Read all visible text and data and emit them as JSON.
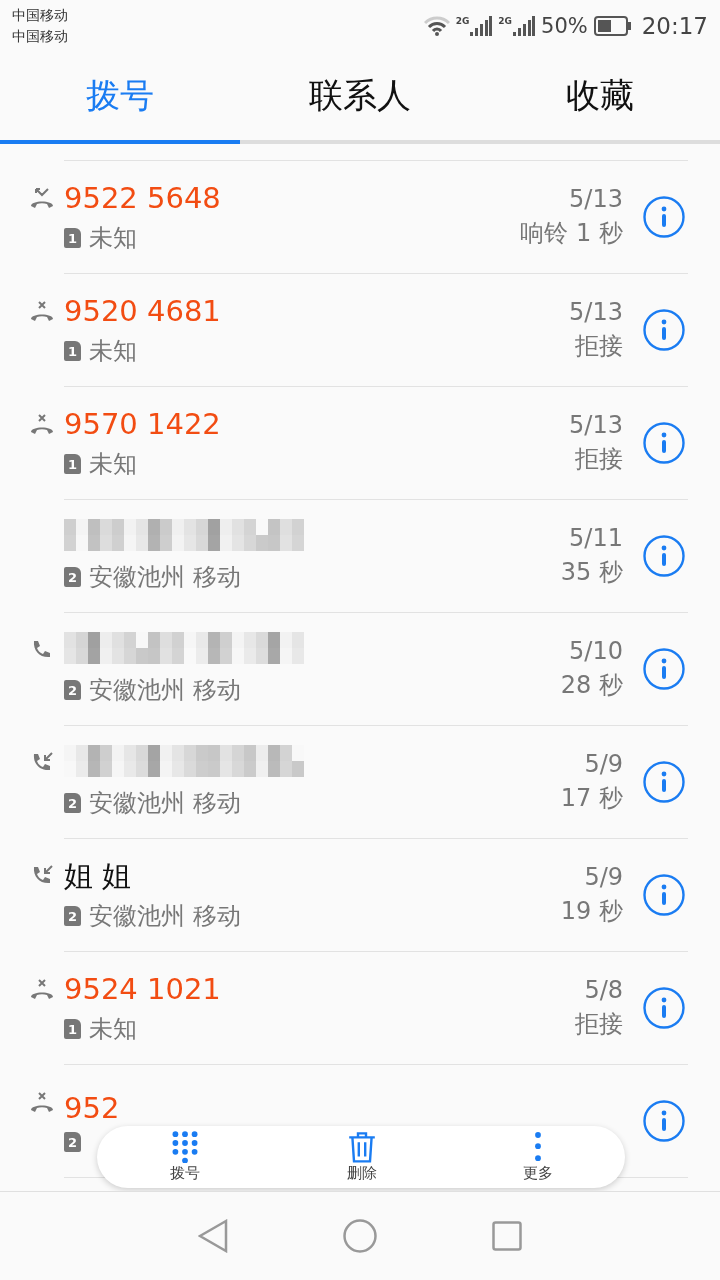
{
  "status_bar": {
    "carriers": [
      "中国移动",
      "中国移动"
    ],
    "network_labels": [
      "2G",
      "2G"
    ],
    "battery_text": "50%",
    "time": "20:17"
  },
  "tabs": [
    {
      "label": "拨号",
      "selected": true
    },
    {
      "label": "联系人",
      "selected": false
    },
    {
      "label": "收藏",
      "selected": false
    }
  ],
  "calls": [
    {
      "kind": "missed",
      "name": "9522 5648",
      "redacted": false,
      "sim": "1",
      "location": "未知",
      "date": "5/13",
      "detail": "响铃 1 秒"
    },
    {
      "kind": "rejected",
      "name": "9520 4681",
      "redacted": false,
      "sim": "1",
      "location": "未知",
      "date": "5/13",
      "detail": "拒接"
    },
    {
      "kind": "rejected",
      "name": "9570 1422",
      "redacted": false,
      "sim": "1",
      "location": "未知",
      "date": "5/13",
      "detail": "拒接"
    },
    {
      "redacted": true,
      "sim": "2",
      "location": "安徽池州 移动",
      "date": "5/11",
      "detail": "35 秒"
    },
    {
      "kind": "outgoing",
      "redacted": true,
      "sim": "2",
      "location": "安徽池州 移动",
      "date": "5/10",
      "detail": "28 秒"
    },
    {
      "kind": "incoming",
      "redacted": true,
      "sim": "2",
      "location": "安徽池州 移动",
      "date": "5/9",
      "detail": "17 秒"
    },
    {
      "kind": "incoming",
      "name": "姐 姐",
      "redacted": false,
      "sim": "2",
      "location": "安徽池州 移动",
      "date": "5/9",
      "detail": "19 秒"
    },
    {
      "kind": "rejected",
      "name": "9524 1021",
      "redacted": false,
      "sim": "1",
      "location": "未知",
      "date": "5/8",
      "detail": "拒接"
    },
    {
      "kind": "rejected",
      "name": "952",
      "redacted": false,
      "sim": "2"
    }
  ],
  "action_bar": [
    {
      "kind": "dialpad",
      "label": "拨号"
    },
    {
      "kind": "delete",
      "label": "删除"
    },
    {
      "kind": "more",
      "label": "更多"
    }
  ]
}
